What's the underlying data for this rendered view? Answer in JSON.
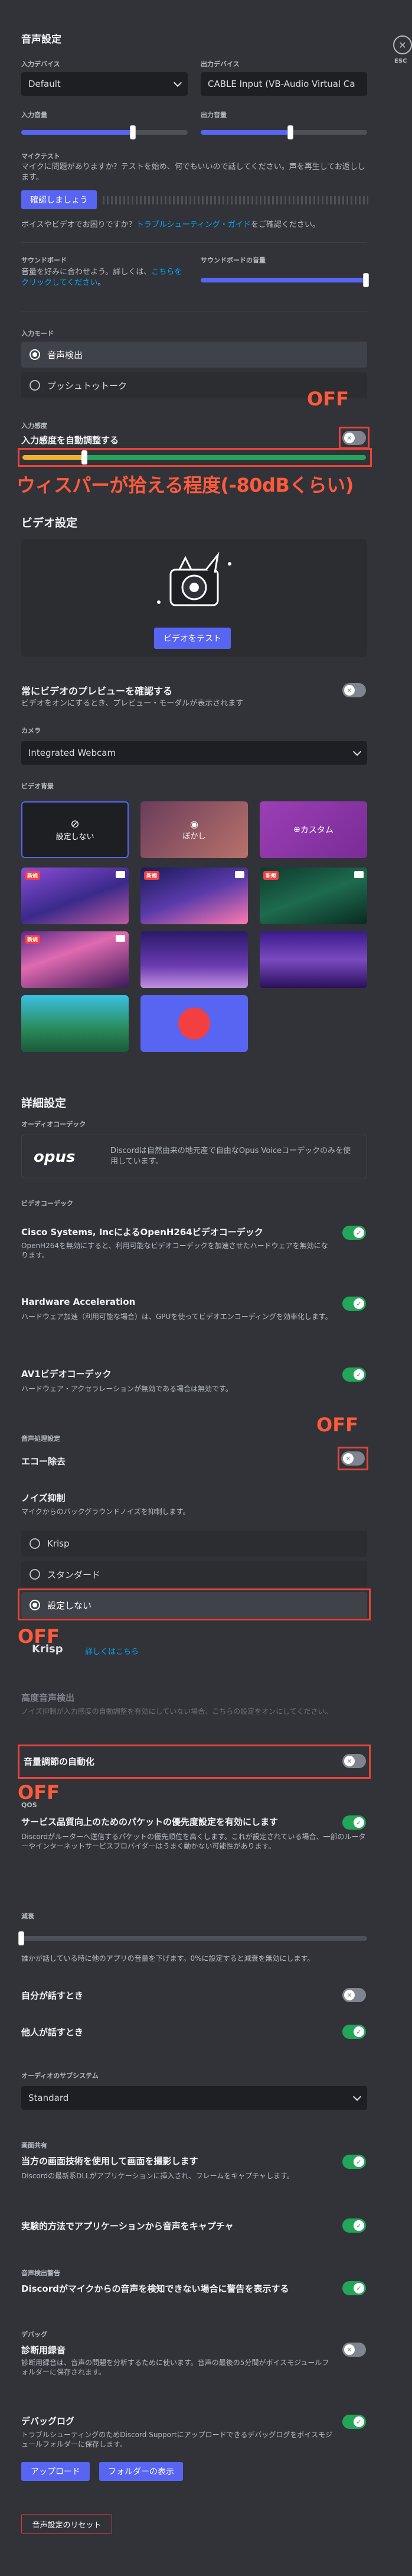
{
  "page": {
    "title": "音声設定",
    "esc_label": "ESC"
  },
  "voice": {
    "input_device_label": "入力デバイス",
    "input_device_value": "Default",
    "output_device_label": "出力デバイス",
    "output_device_value": "CABLE Input (VB-Audio Virtual Ca",
    "input_volume_label": "入力音量",
    "input_volume": 0.67,
    "output_volume_label": "出力音量",
    "output_volume": 0.54,
    "mic_test_label": "マイクテスト",
    "mic_test_desc": "マイクに問題がありますか？テストを始め、何でもいいので話してください。声を再生してお返しします。",
    "mic_test_button": "確認しましょう",
    "help_prefix": "ボイスやビデオでお困りですか？",
    "help_link": "トラブルシューティング・ガイド",
    "help_suffix": "をご確認ください。",
    "soundboard_label": "サウンドボード",
    "soundboard_desc_prefix": "音量を好みに合わせよう。詳しくは、",
    "soundboard_desc_link": "こちらをクリックしてください",
    "soundboard_desc_suffix": "。",
    "soundboard_volume_label": "サウンドボードの音量",
    "soundboard_volume": 1.0,
    "input_mode_label": "入力モード",
    "input_mode_options": [
      "音声検出",
      "プッシュトゥトーク"
    ],
    "input_mode_selected": 0,
    "sensitivity_label": "入力感度",
    "auto_sensitivity_label": "入力感度を自動調整する",
    "auto_sensitivity_on": false,
    "sensitivity_level": 0.18
  },
  "annotations": {
    "off_1": "OFF",
    "whisper": "ウィスパーが拾える程度(-80dBくらい)",
    "off_2": "OFF",
    "off_3": "OFF",
    "off_4": "OFF",
    "color": "#e8443a"
  },
  "video": {
    "title": "ビデオ設定",
    "test_button": "ビデオをテスト",
    "preview_title": "常にビデオのプレビューを確認する",
    "preview_desc": "ビデオをオンにするとき、プレビュー・モーダルが表示されます",
    "preview_on": false,
    "camera_label": "カメラ",
    "camera_value": "Integrated Webcam",
    "bg_label": "ビデオ背景",
    "bg_none": "設定しない",
    "bg_blur": "ぼかし",
    "bg_custom": "カスタム",
    "new_badge": "新規"
  },
  "advanced": {
    "title": "詳細設定",
    "codec_label": "オーディオコーデック",
    "opus_logo": "opus",
    "codec_desc": "Discordは自然由来の地元産で自由なOpus Voiceコーデックのみを使用しています。",
    "video_codec_label": "ビデオコーデック",
    "openh264_title": "Cisco Systems, IncによるOpenH264ビデオコーデック",
    "openh264_desc": "OpenH264を無効にすると、利用可能なビデオコーデックを加速させたハードウェアを無効になります。",
    "openh264_on": true,
    "hwaccel_title": "Hardware Acceleration",
    "hwaccel_desc": "ハードウェア加速（利用可能な場合）は、GPUを使ってビデオエンコーディングを効率化します。",
    "hwaccel_on": true,
    "av1_title": "AV1ビデオコーデック",
    "av1_desc": "ハードウェア・アクセラレーションが無効である場合は無効です。",
    "av1_on": true,
    "processing_label": "音声処理設定",
    "echo_title": "エコー除去",
    "echo_on": false,
    "noise_label": "ノイズ抑制",
    "noise_desc": "マイクからのバックグラウンドノイズを抑制します。",
    "noise_options": [
      "Krisp",
      "スタンダード",
      "設定しない"
    ],
    "noise_selected": 2,
    "krisp_logo": "Krisp",
    "krisp_link": "詳しくはこちら",
    "advanced_va_title": "高度音声検出",
    "advanced_va_desc": "ノイズ抑制が入力感度の自動調整を有効にしていない場合、こちらの設定をオンにしてください。",
    "agc_title": "音量調節の自動化",
    "agc_on": false,
    "qos_label": "QOS",
    "qos_title": "サービス品質向上のためのパケットの優先度設定を有効にします",
    "qos_desc": "Discordがルーターへ送信するパケットの優先順位を高くします。これが設定されている場合、一部のルーターやインターネットサービスプロバイダーはうまく動かない可能性があります。",
    "qos_on": true,
    "attenuation_label": "減衰",
    "attenuation_desc": "誰かが話している時に他のアプリの音量を下げます。0%に設定すると減衰を無効にします。",
    "attenuation_value": 0.0,
    "when_i_speak": "自分が話すとき",
    "when_i_speak_on": false,
    "when_others_speak": "他人が話すとき",
    "when_others_speak_on": true,
    "subsystem_label": "オーディオのサブシステム",
    "subsystem_value": "Standard",
    "screen_share_label": "画面共有",
    "screen_capture_title": "当方の画面技術を使用して画面を撮影します",
    "screen_capture_desc": "Discordの最新系DLLがアプリケーションに挿入され、フレームをキャプチャします。",
    "screen_capture_on": true,
    "experimental_title": "実験的方法でアプリケーションから音声をキャプチャ",
    "experimental_on": true,
    "voice_diag_label": "音声検出警告",
    "voice_warn_title": "Discordがマイクからの音声を検知できない場合に警告を表示する",
    "voice_warn_on": true,
    "debug_label": "デバッグ",
    "diag_title": "診断用録音",
    "diag_desc": "診断用録音は、音声の問題を分析するために使います。音声の最後の5分間がボイスモジュールフォルダーに保存されます。",
    "diag_on": false,
    "debug_log_title": "デバッグログ",
    "debug_log_desc": "トラブルシューティングのためDiscord Supportにアップロードできるデバッグログをボイスモジュールフォルダーに保存します。",
    "debug_log_on": true,
    "upload_button": "アップロード",
    "folder_button": "フォルダーの表示",
    "reset_button": "音声設定のリセット"
  }
}
